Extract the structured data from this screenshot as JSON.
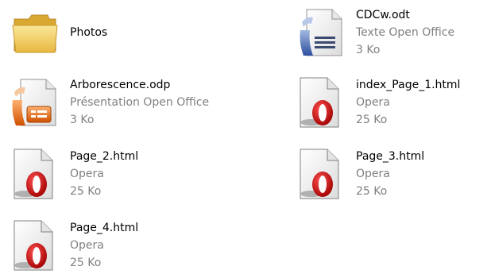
{
  "files": [
    {
      "name": "Photos",
      "type": "",
      "size": "",
      "icon": "folder-icon"
    },
    {
      "name": "CDCw.odt",
      "type": "Texte Open Office",
      "size": "3 Ko",
      "icon": "openoffice-writer-icon"
    },
    {
      "name": "Arborescence.odp",
      "type": "Présentation Open Office",
      "size": "3 Ko",
      "icon": "openoffice-impress-icon"
    },
    {
      "name": "index_Page_1.html",
      "type": "Opera",
      "size": "25 Ko",
      "icon": "opera-html-icon"
    },
    {
      "name": "Page_2.html",
      "type": "Opera",
      "size": "25 Ko",
      "icon": "opera-html-icon"
    },
    {
      "name": "Page_3.html",
      "type": "Opera",
      "size": "25 Ko",
      "icon": "opera-html-icon"
    },
    {
      "name": "Page_4.html",
      "type": "Opera",
      "size": "25 Ko",
      "icon": "opera-html-icon"
    }
  ],
  "colors": {
    "name_text": "#000000",
    "secondary_text": "#808080",
    "folder_yellow": "#f5d46a",
    "opera_red": "#d01010",
    "impress_orange": "#e8701a",
    "writer_blue": "#4060a0"
  }
}
